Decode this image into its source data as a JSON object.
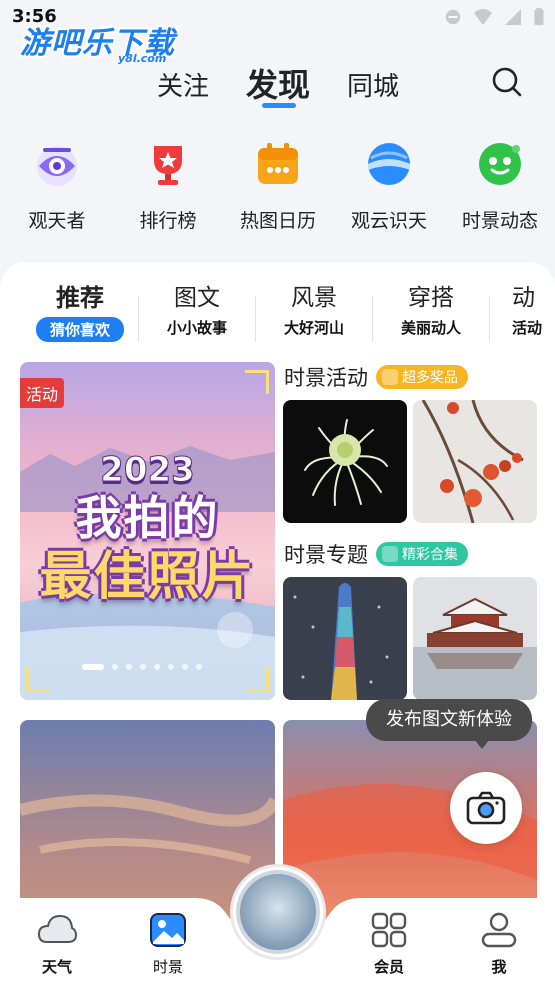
{
  "status": {
    "time": "3:56",
    "watermark": "游吧乐下载",
    "watermark_sub": "y8l.com",
    "icons": [
      "do-not-disturb-icon",
      "wifi-icon",
      "cellular-signal-icon",
      "battery-icon"
    ]
  },
  "topnav": {
    "tabs": [
      {
        "label": "关注",
        "active": false
      },
      {
        "label": "发现",
        "active": true
      },
      {
        "label": "同城",
        "active": false
      }
    ],
    "accent": "#2a8cff",
    "search_icon": "search-icon"
  },
  "quick": [
    {
      "label": "观天者",
      "icon": "eye-icon",
      "color": "#7d5cf0"
    },
    {
      "label": "排行榜",
      "icon": "trophy-icon",
      "color": "#ef3b3b"
    },
    {
      "label": "热图日历",
      "icon": "calendar-icon",
      "color": "#f7a418"
    },
    {
      "label": "观云识天",
      "icon": "cloud-globe-icon",
      "color": "#2a8cff"
    },
    {
      "label": "时景动态",
      "icon": "planet-icon",
      "color": "#2fc34a"
    }
  ],
  "categories": [
    {
      "title": "推荐",
      "sub": "猜你喜欢",
      "active": true
    },
    {
      "title": "图文",
      "sub": "小小故事",
      "active": false
    },
    {
      "title": "风景",
      "sub": "大好河山",
      "active": false
    },
    {
      "title": "穿搭",
      "sub": "美丽动人",
      "active": false
    },
    {
      "title": "动",
      "sub": "活动",
      "active": false
    }
  ],
  "banner": {
    "badge": "活动",
    "year": "2023",
    "line1": "我拍的",
    "line2": "最佳照片",
    "slides": 8,
    "active_slide": 0
  },
  "sections": {
    "activity": {
      "title": "时景活动",
      "pill": "超多奖品",
      "pill_color": "#f7b524"
    },
    "topic": {
      "title": "时景专题",
      "pill": "精彩合集",
      "pill_color": "#2ec7a1"
    }
  },
  "tooltip": {
    "text": "发布图文新体验"
  },
  "camera_icon": "camera-icon",
  "bottom": [
    {
      "label": "天气",
      "icon": "cloud-icon"
    },
    {
      "label": "时景",
      "icon": "picture-icon",
      "active": true
    },
    {
      "label": "会员",
      "icon": "grid-icon"
    },
    {
      "label": "我",
      "icon": "user-icon"
    }
  ]
}
